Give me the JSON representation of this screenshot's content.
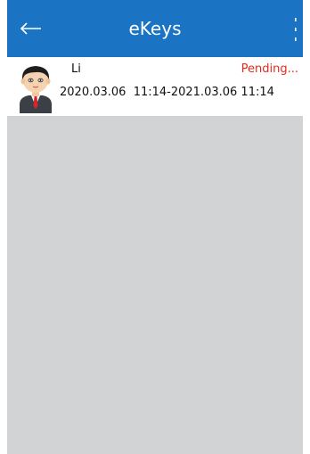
{
  "header": {
    "title": "eKeys",
    "back_icon": "arrow-left-icon",
    "menu_icon": "more-vertical-icon",
    "background_color": "#1a73c3"
  },
  "ekeys": [
    {
      "avatar_icon": "user-avatar-icon",
      "name": "Li",
      "status": "Pending...",
      "status_color": "#e8291c",
      "validity": "2020.03.06  11:14-2021.03.06 11:14"
    }
  ],
  "list_background_color": "#d2d3d5"
}
